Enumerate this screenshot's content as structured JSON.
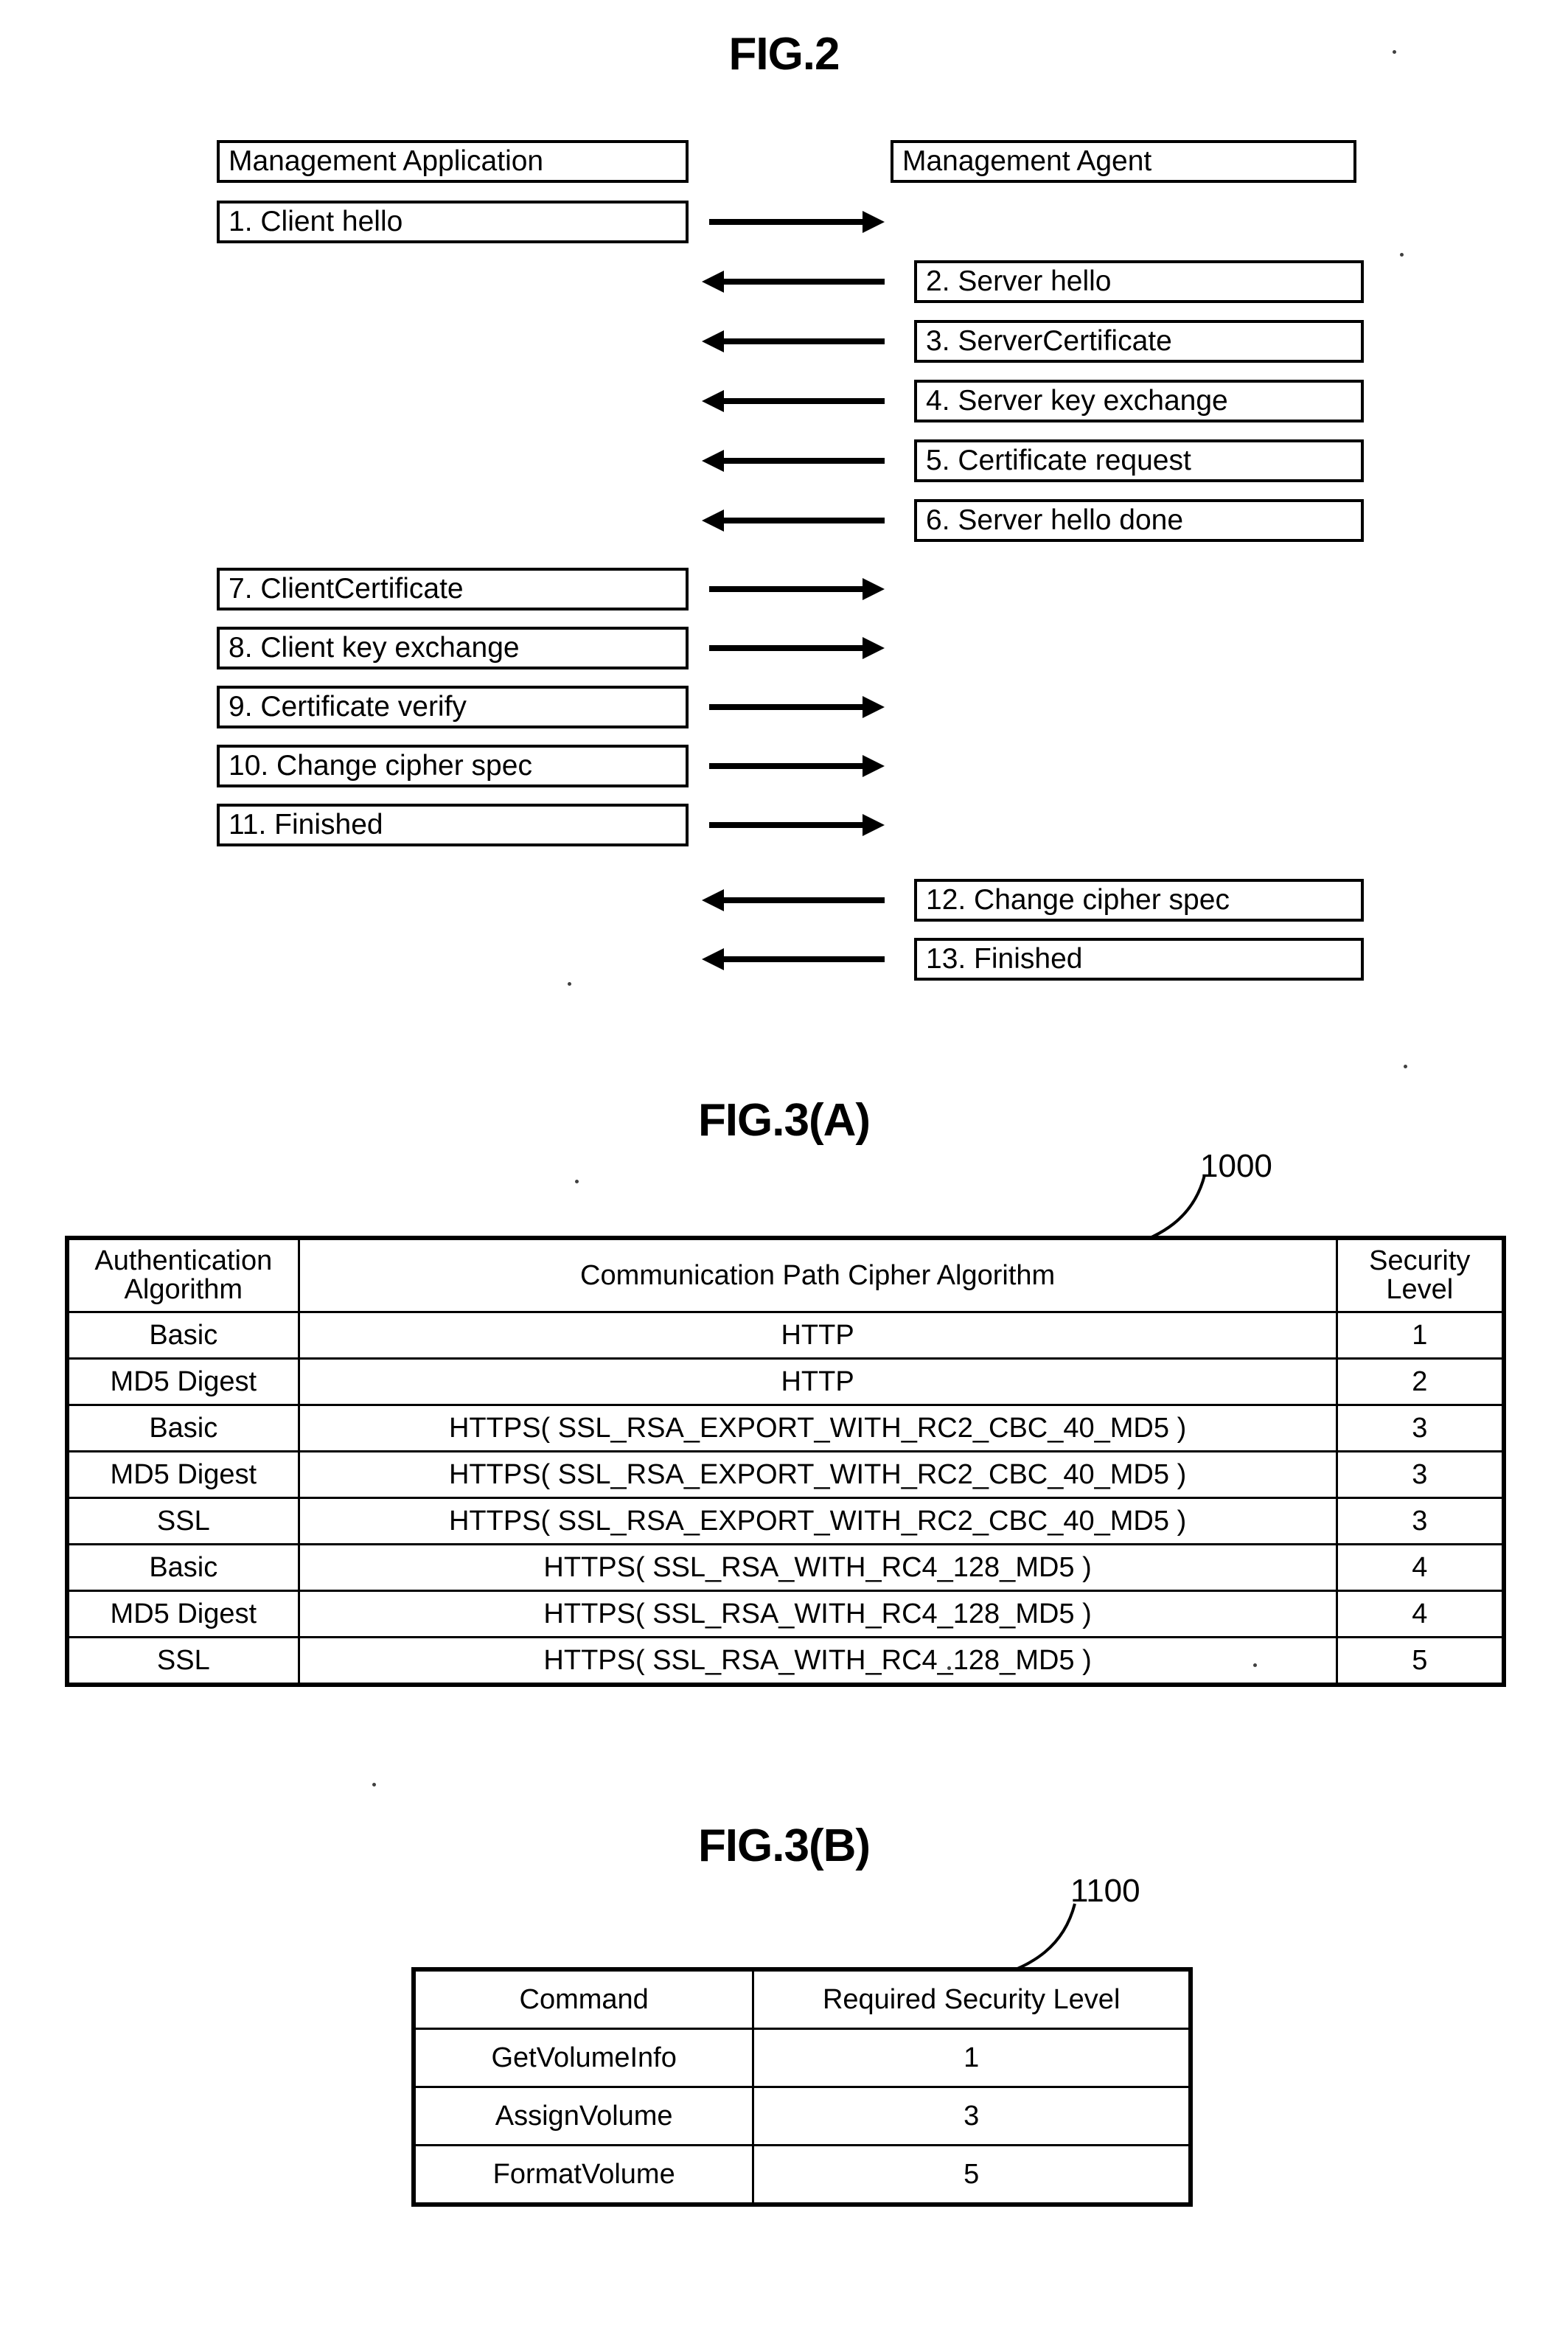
{
  "figures": {
    "fig2": {
      "title": "FIG.2",
      "actors": {
        "left": "Management Application",
        "right": "Management Agent"
      },
      "messages": [
        {
          "label": "1. Client hello",
          "side": "left",
          "direction": "right"
        },
        {
          "label": "2. Server hello",
          "side": "right",
          "direction": "left"
        },
        {
          "label": "3. ServerCertificate",
          "side": "right",
          "direction": "left"
        },
        {
          "label": "4. Server key exchange",
          "side": "right",
          "direction": "left"
        },
        {
          "label": "5. Certificate request",
          "side": "right",
          "direction": "left"
        },
        {
          "label": "6. Server hello done",
          "side": "right",
          "direction": "left"
        },
        {
          "label": "7. ClientCertificate",
          "side": "left",
          "direction": "right"
        },
        {
          "label": "8. Client key exchange",
          "side": "left",
          "direction": "right"
        },
        {
          "label": "9. Certificate verify",
          "side": "left",
          "direction": "right"
        },
        {
          "label": "10. Change cipher spec",
          "side": "left",
          "direction": "right"
        },
        {
          "label": "11. Finished",
          "side": "left",
          "direction": "right"
        },
        {
          "label": "12. Change cipher spec",
          "side": "right",
          "direction": "left"
        },
        {
          "label": "13. Finished",
          "side": "right",
          "direction": "left"
        }
      ]
    },
    "fig3a": {
      "title": "FIG.3(A)",
      "reference_numeral": "1000",
      "columns": [
        "Authentication Algorithm",
        "Communication Path Cipher Algorithm",
        "Security Level"
      ],
      "column_lines": [
        [
          "Authentication",
          "Algorithm"
        ],
        [
          "Communication Path Cipher Algorithm"
        ],
        [
          "Security",
          "Level"
        ]
      ],
      "rows": [
        {
          "auth": "Basic",
          "cipher": "HTTP",
          "level": "1"
        },
        {
          "auth": "MD5 Digest",
          "cipher": "HTTP",
          "level": "2"
        },
        {
          "auth": "Basic",
          "cipher": "HTTPS( SSL_RSA_EXPORT_WITH_RC2_CBC_40_MD5 )",
          "level": "3"
        },
        {
          "auth": "MD5 Digest",
          "cipher": "HTTPS( SSL_RSA_EXPORT_WITH_RC2_CBC_40_MD5 )",
          "level": "3"
        },
        {
          "auth": "SSL",
          "cipher": "HTTPS( SSL_RSA_EXPORT_WITH_RC2_CBC_40_MD5 )",
          "level": "3"
        },
        {
          "auth": "Basic",
          "cipher": "HTTPS( SSL_RSA_WITH_RC4_128_MD5 )",
          "level": "4"
        },
        {
          "auth": "MD5 Digest",
          "cipher": "HTTPS( SSL_RSA_WITH_RC4_128_MD5 )",
          "level": "4"
        },
        {
          "auth": "SSL",
          "cipher": "HTTPS( SSL_RSA_WITH_RC4_128_MD5 )",
          "level": "5"
        }
      ]
    },
    "fig3b": {
      "title": "FIG.3(B)",
      "reference_numeral": "1100",
      "columns": [
        "Command",
        "Required Security Level"
      ],
      "rows": [
        {
          "command": "GetVolumeInfo",
          "level": "1"
        },
        {
          "command": "AssignVolume",
          "level": "3"
        },
        {
          "command": "FormatVolume",
          "level": "5"
        }
      ]
    }
  },
  "chart_data": {
    "type": "table",
    "title": "FIG.3(A) / FIG.3(B) security level mapping tables",
    "tables": [
      {
        "name": "1000",
        "columns": [
          "Authentication Algorithm",
          "Communication Path Cipher Algorithm",
          "Security Level"
        ],
        "rows": [
          [
            "Basic",
            "HTTP",
            1
          ],
          [
            "MD5 Digest",
            "HTTP",
            2
          ],
          [
            "Basic",
            "HTTPS( SSL_RSA_EXPORT_WITH_RC2_CBC_40_MD5 )",
            3
          ],
          [
            "MD5 Digest",
            "HTTPS( SSL_RSA_EXPORT_WITH_RC2_CBC_40_MD5 )",
            3
          ],
          [
            "SSL",
            "HTTPS( SSL_RSA_EXPORT_WITH_RC2_CBC_40_MD5 )",
            3
          ],
          [
            "Basic",
            "HTTPS( SSL_RSA_WITH_RC4_128_MD5 )",
            4
          ],
          [
            "MD5 Digest",
            "HTTPS( SSL_RSA_WITH_RC4_128_MD5 )",
            4
          ],
          [
            "SSL",
            "HTTPS( SSL_RSA_WITH_RC4_128_MD5 )",
            5
          ]
        ]
      },
      {
        "name": "1100",
        "columns": [
          "Command",
          "Required Security Level"
        ],
        "rows": [
          [
            "GetVolumeInfo",
            1
          ],
          [
            "AssignVolume",
            3
          ],
          [
            "FormatVolume",
            5
          ]
        ]
      }
    ]
  }
}
